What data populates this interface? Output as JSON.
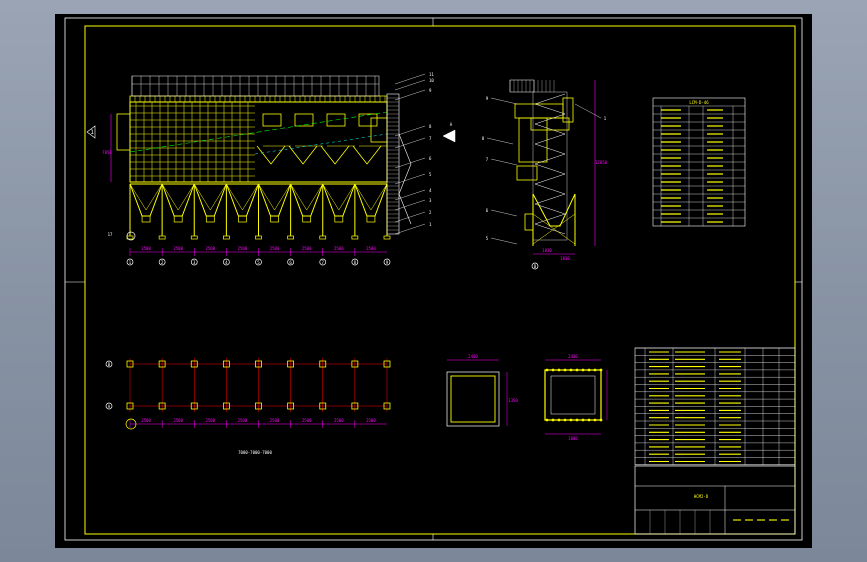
{
  "colors": {
    "background": "#000000",
    "frame": "#ffff00",
    "structure": "#ffff00",
    "dimension": "#ff00ff",
    "text": "#ffffff",
    "leader": "#ffffff",
    "axis": "#ff0000",
    "cyan": "#00ffff",
    "green": "#00ff00"
  },
  "front_view": {
    "column_spacings": [
      "2500",
      "2500",
      "2500",
      "2500",
      "2500",
      "2500",
      "2500",
      "2500"
    ],
    "elevation_label": "7850",
    "part_numbers": [
      "11",
      "10",
      "9",
      "8",
      "7",
      "6",
      "5",
      "4",
      "3",
      "2",
      "1"
    ],
    "axis_numbers": [
      "1",
      "2",
      "3",
      "4",
      "5",
      "6",
      "7",
      "8",
      "9"
    ],
    "inlet_label": "A"
  },
  "side_view": {
    "part_numbers": [
      "9",
      "8",
      "7",
      "6",
      "5"
    ],
    "overall_height": "12850",
    "widths": [
      "1810",
      "1810"
    ],
    "axis_label": "B"
  },
  "plan_view": {
    "spacings": [
      "2500",
      "2500",
      "2500",
      "2500",
      "2500",
      "2500",
      "2500",
      "2500"
    ],
    "caption": "7000-7000-7000",
    "axis_letters": [
      "B",
      "A"
    ]
  },
  "detail_left": {
    "dims": [
      "2400",
      "1350"
    ]
  },
  "detail_right": {
    "dims": [
      "2400",
      "1800"
    ]
  },
  "tech_table": {
    "title": "LCM-D-46",
    "rows": 15
  },
  "parts_list": {
    "rows": 16,
    "drawing_no": "HCM2-D"
  }
}
